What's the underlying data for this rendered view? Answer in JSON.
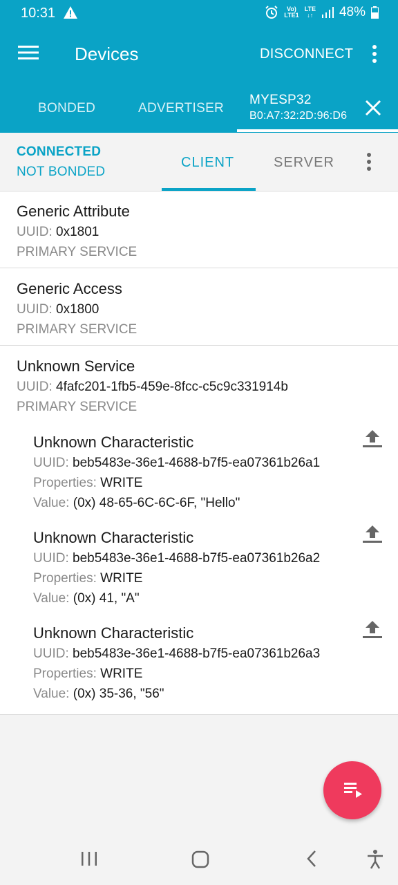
{
  "status_bar": {
    "time": "10:31",
    "battery": "48%",
    "volte": [
      "Vo)",
      "LTE1"
    ],
    "lte": "LTE"
  },
  "app_bar": {
    "title": "Devices",
    "disconnect": "DISCONNECT"
  },
  "top_tabs": {
    "bonded": "BONDED",
    "advertiser": "ADVERTISER",
    "device_name": "MYESP32",
    "device_address": "B0:A7:32:2D:96:D6"
  },
  "sub_bar": {
    "connection": "CONNECTED",
    "bonding": "NOT BONDED",
    "client": "CLIENT",
    "server": "SERVER"
  },
  "labels": {
    "uuid": "UUID:",
    "properties": "Properties:",
    "value": "Value:"
  },
  "services": [
    {
      "name": "Generic Attribute",
      "uuid": "0x1801",
      "type": "PRIMARY SERVICE"
    },
    {
      "name": "Generic Access",
      "uuid": "0x1800",
      "type": "PRIMARY SERVICE"
    },
    {
      "name": "Unknown Service",
      "uuid": "4fafc201-1fb5-459e-8fcc-c5c9c331914b",
      "type": "PRIMARY SERVICE",
      "characteristics": [
        {
          "name": "Unknown Characteristic",
          "uuid": "beb5483e-36e1-4688-b7f5-ea07361b26a1",
          "properties": "WRITE",
          "value": "(0x) 48-65-6C-6C-6F, \"Hello\""
        },
        {
          "name": "Unknown Characteristic",
          "uuid": "beb5483e-36e1-4688-b7f5-ea07361b26a2",
          "properties": "WRITE",
          "value": "(0x) 41, \"A\""
        },
        {
          "name": "Unknown Characteristic",
          "uuid": "beb5483e-36e1-4688-b7f5-ea07361b26a3",
          "properties": "WRITE",
          "value": "(0x) 35-36, \"56\""
        }
      ]
    }
  ],
  "colors": {
    "primary": "#0aa3c6",
    "fab": "#ef3a5d"
  },
  "icons": [
    "warning-icon",
    "alarm-icon",
    "signal-icon",
    "battery-icon",
    "menu-icon",
    "more-vert-icon",
    "close-icon",
    "upload-icon",
    "log-icon",
    "recent-apps-icon",
    "home-icon",
    "back-icon",
    "accessibility-icon"
  ]
}
